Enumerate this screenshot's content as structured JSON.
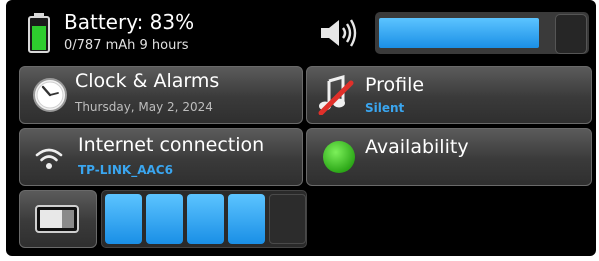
{
  "status": {
    "battery_title": "Battery: 83%",
    "battery_detail": "0/787 mAh  9 hours",
    "battery_level": 0.83,
    "volume_level": 0.9
  },
  "tiles": {
    "clock": {
      "title": "Clock & Alarms",
      "subtitle": "Thursday, May  2, 2024"
    },
    "profile": {
      "title": "Profile",
      "subtitle": "Silent"
    },
    "internet": {
      "title": "Internet connection",
      "subtitle": "TP-LINK_AAC6"
    },
    "availability": {
      "title": "Availability"
    }
  },
  "brightness": {
    "segments_total": 5,
    "segments_on": 4
  },
  "icons": {
    "battery": "battery-icon",
    "speaker": "speaker-icon",
    "clock": "clock-icon",
    "profile": "silent-profile-icon",
    "wifi": "wifi-icon",
    "availability": "availability-status-icon",
    "toggle": "screen-lock-toggle-icon"
  },
  "colors": {
    "accent_blue": "#3aa6f0",
    "subtitle_blue": "#3aa6f0",
    "battery_green": "#2ecc2e",
    "available_green": "#3ccc1f",
    "panel_bg": "#000000",
    "tile_bg": "#404040"
  }
}
